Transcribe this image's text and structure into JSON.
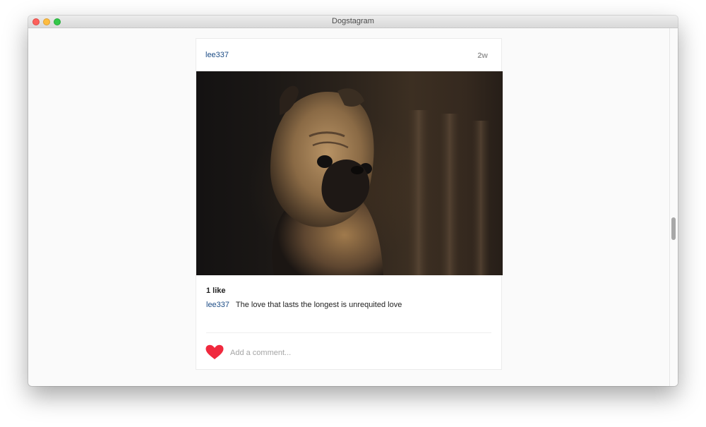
{
  "window": {
    "title": "Dogstagram"
  },
  "post": {
    "username": "lee337",
    "time_ago": "2w",
    "photo_subject": "pug",
    "likes_text": "1 like",
    "caption": {
      "username": "lee337",
      "text": "The love that lasts the longest is unrequited love"
    },
    "liked": true
  },
  "comment": {
    "placeholder": "Add a comment..."
  },
  "colors": {
    "username_blue": "#1b4b85",
    "heart_red": "#f0293e",
    "background": "#fafafa"
  },
  "icons": {
    "like": "heart-icon"
  }
}
